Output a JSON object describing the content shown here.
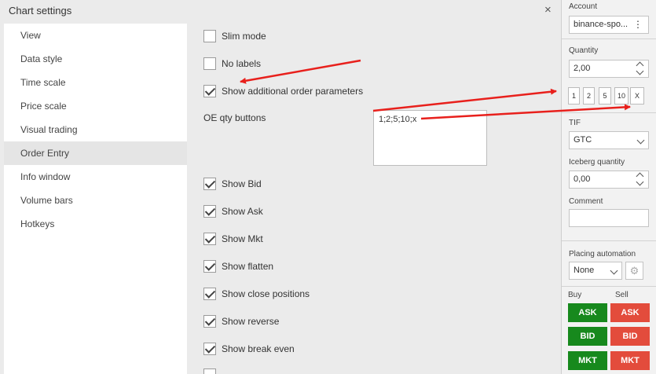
{
  "dialog": {
    "title": "Chart settings",
    "close_symbol": "×",
    "nav": [
      {
        "label": "View"
      },
      {
        "label": "Data style"
      },
      {
        "label": "Time scale"
      },
      {
        "label": "Price scale"
      },
      {
        "label": "Visual trading"
      },
      {
        "label": "Order Entry",
        "active": true
      },
      {
        "label": "Info window"
      },
      {
        "label": "Volume bars"
      },
      {
        "label": "Hotkeys"
      }
    ],
    "options_top": [
      {
        "label": "Slim mode",
        "checked": false
      },
      {
        "label": "No labels",
        "checked": false
      },
      {
        "label": "Show additional order parameters",
        "checked": true
      }
    ],
    "oe_qty": {
      "label": "OE qty buttons",
      "value": "1;2;5;10;x"
    },
    "options_bottom": [
      {
        "label": "Show Bid",
        "checked": true
      },
      {
        "label": "Show Ask",
        "checked": true
      },
      {
        "label": "Show Mkt",
        "checked": true
      },
      {
        "label": "Show flatten",
        "checked": true
      },
      {
        "label": "Show close positions",
        "checked": true
      },
      {
        "label": "Show reverse",
        "checked": true
      },
      {
        "label": "Show break even",
        "checked": true
      }
    ]
  },
  "panel": {
    "account_label": "Account",
    "account_value": "binance-spo...",
    "account_menu_icon": "⋮",
    "quantity_label": "Quantity",
    "quantity_value": "2,00",
    "qty_buttons": [
      "1",
      "2",
      "5",
      "10",
      "X"
    ],
    "tif_label": "TIF",
    "tif_value": "GTC",
    "iceberg_label": "Iceberg quantity",
    "iceberg_value": "0,00",
    "comment_label": "Comment",
    "comment_value": "",
    "placing_label": "Placing automation",
    "placing_value": "None",
    "gear_icon": "⚙",
    "buy_label": "Buy",
    "sell_label": "Sell",
    "buy_buttons": [
      "ASK",
      "BID",
      "MKT"
    ],
    "sell_buttons": [
      "ASK",
      "BID",
      "MKT"
    ],
    "colors": {
      "buy": "#17891d",
      "sell": "#e34c3c"
    }
  },
  "annotations": {
    "arrow_color": "#e8201c"
  }
}
